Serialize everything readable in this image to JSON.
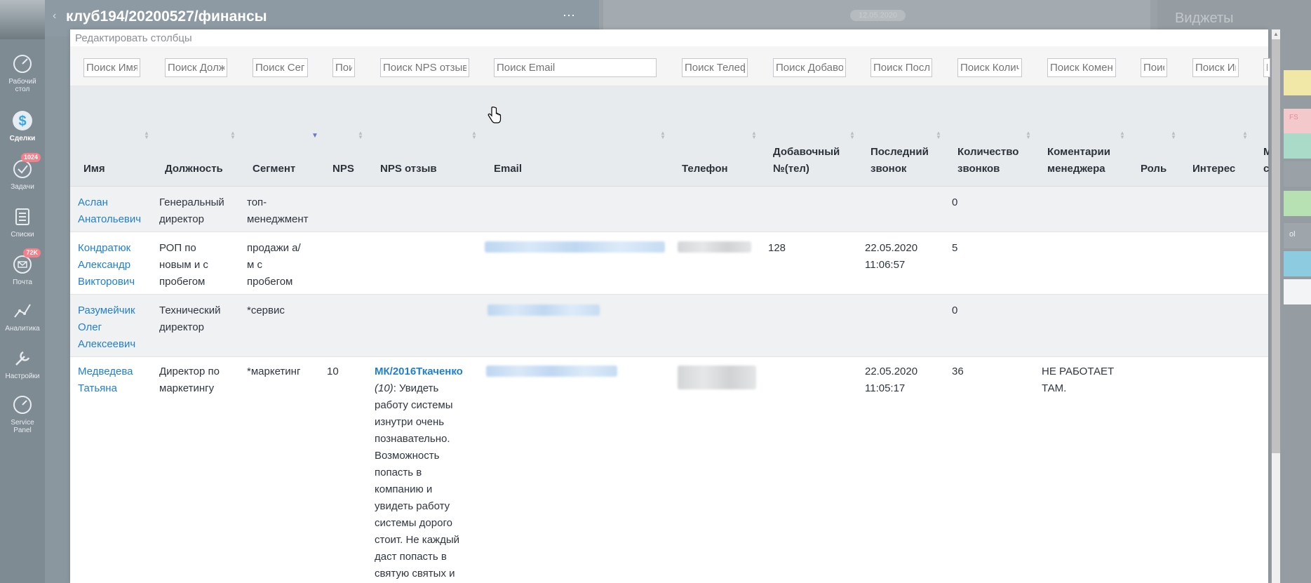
{
  "app": {
    "title": "клуб194/20200527/финансы",
    "back_icon": "chevron-left-icon",
    "menu_icon": "more-dots-icon"
  },
  "nav": [
    {
      "label": "Рабочий стол",
      "line1": "Рабочий",
      "line2": "стол",
      "icon": "dashboard-icon"
    },
    {
      "label": "Сделки",
      "line1": "Сделки",
      "line2": "",
      "icon": "dollar-icon",
      "active": true
    },
    {
      "label": "Задачи",
      "line1": "Задачи",
      "line2": "",
      "icon": "check-icon",
      "badge": "1024"
    },
    {
      "label": "Списки",
      "line1": "Списки",
      "line2": "",
      "icon": "list-icon"
    },
    {
      "label": "Почта",
      "line1": "Почта",
      "line2": "",
      "icon": "mail-icon",
      "badge": "72K"
    },
    {
      "label": "Аналитика",
      "line1": "Аналитика",
      "line2": "",
      "icon": "analytics-icon"
    },
    {
      "label": "Настройки",
      "line1": "Настройки",
      "line2": "",
      "icon": "settings-icon"
    },
    {
      "label": "Service Panel",
      "line1": "Service",
      "line2": "Panel",
      "icon": "service-icon"
    }
  ],
  "feed": {
    "date": "12.05.2020"
  },
  "widgets": {
    "title": "Виджеты",
    "strip_colors": [
      "#f1e8a8",
      "#f4c9cc",
      "#a9dbc8",
      "#9aa2a8",
      "#b7e0b3",
      "#9ea6ab",
      "#8ccbe0",
      "#f2f4f5"
    ],
    "fs_label": "FS",
    "pl_label": "ol"
  },
  "modal": {
    "caption": "Редактировать столбцы",
    "search_placeholders": [
      "Поиск Имя",
      "Поиск Должность",
      "Поиск Сегмент",
      "Поиск NPS",
      "Поиск NPS отзыв",
      "Поиск Email",
      "Поиск Телефон",
      "Поиск Добавочный",
      "Поиск Последний",
      "Поиск Количество",
      "Поиск Коментарии",
      "Поиск Роль",
      "Поиск Интерес",
      "Поиск"
    ],
    "columns": [
      {
        "line1": "Имя",
        "line2": ""
      },
      {
        "line1": "Должность",
        "line2": ""
      },
      {
        "line1": "Сегмент",
        "line2": ""
      },
      {
        "line1": "NPS",
        "line2": ""
      },
      {
        "line1": "NPS отзыв",
        "line2": ""
      },
      {
        "line1": "Email",
        "line2": ""
      },
      {
        "line1": "Телефон",
        "line2": ""
      },
      {
        "line1": "Добавочный",
        "line2": "№(тел)"
      },
      {
        "line1": "Последний",
        "line2": "звонок"
      },
      {
        "line1": "Количество",
        "line2": "звонков"
      },
      {
        "line1": "Коментарии",
        "line2": "менеджера"
      },
      {
        "line1": "Роль",
        "line2": ""
      },
      {
        "line1": "Интерес",
        "line2": ""
      },
      {
        "line1": "М",
        "line2": "с"
      }
    ],
    "rows": [
      {
        "name": [
          "Аслан",
          "Анатольевич"
        ],
        "position": [
          "Генеральный",
          "директор"
        ],
        "segment": [
          "топ-",
          "менеджмент"
        ],
        "calls": "0"
      },
      {
        "name": [
          "Кондратюк",
          "Александр",
          "Викторович"
        ],
        "position": [
          "РОП по",
          "новым и с",
          "пробегом"
        ],
        "segment": [
          "продажи а/",
          "м с",
          "пробегом"
        ],
        "ext": "128",
        "last_call": [
          "22.05.2020",
          "11:06:57"
        ],
        "calls": "5"
      },
      {
        "name": [
          "Разумейчик",
          "Олег",
          "Алексеевич"
        ],
        "position": [
          "Технический",
          "директор"
        ],
        "segment": [
          "*сервис"
        ],
        "calls": "0"
      },
      {
        "name": [
          "Медведева",
          "Татьяна"
        ],
        "position": [
          "Директор по",
          "маркетингу"
        ],
        "segment": [
          "*маркетинг"
        ],
        "nps": "10",
        "nps_link": "МК/2016Ткаченко",
        "nps_score": "(10)",
        "nps_text": [
          ": Увидеть",
          "работу системы",
          "изнутри очень",
          "познавательно.",
          "Возможность",
          "попасть в",
          "компанию и",
          "увидеть работу",
          "системы дорого",
          "стоит. Не каждый",
          "даст попасть в",
          "святую святых и"
        ],
        "last_call": [
          "22.05.2020",
          "11:05:17"
        ],
        "calls": "36",
        "comment": [
          "НЕ РАБОТАЕТ",
          "ТАМ."
        ]
      }
    ]
  }
}
